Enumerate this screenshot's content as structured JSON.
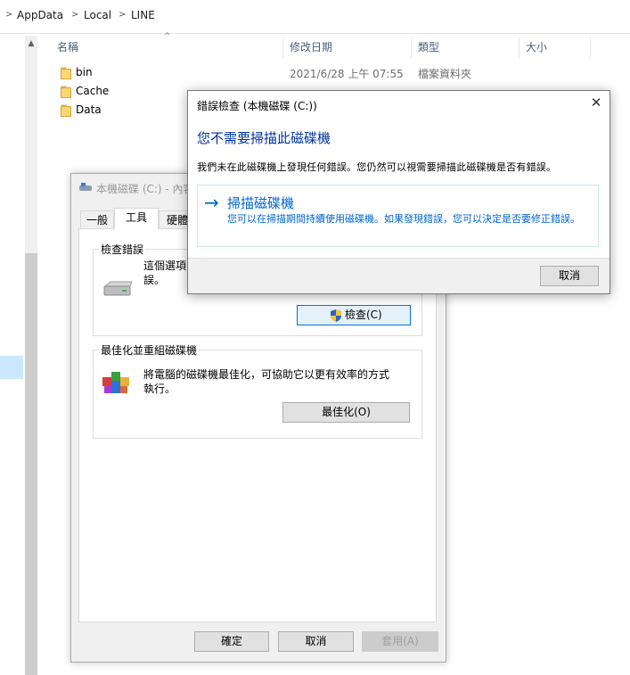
{
  "breadcrumb": {
    "items": [
      "AppData",
      "Local",
      "LINE"
    ]
  },
  "columns": {
    "name": "名稱",
    "modified": "修改日期",
    "type": "類型",
    "size": "大小"
  },
  "files": [
    {
      "name": "bin",
      "date": "2021/6/28 上午 07:55",
      "type": "檔案資料夾"
    },
    {
      "name": "Cache",
      "date": "",
      "type": ""
    },
    {
      "name": "Data",
      "date": "",
      "type": ""
    }
  ],
  "properties_dialog": {
    "title": "本機磁碟 (C:) - 內容",
    "tabs": [
      "一般",
      "工具",
      "硬體"
    ],
    "active_tab": "工具",
    "error_check_group": {
      "legend": "檢查錯誤",
      "text": "這個選項\n誤。",
      "button": "檢查(C)"
    },
    "optimize_group": {
      "legend": "最佳化並重組磁碟機",
      "text_line1": "將電腦的磁碟機最佳化，可協助它以更有效率的方式",
      "text_line2": "執行。",
      "button": "最佳化(O)"
    },
    "buttons": {
      "ok": "確定",
      "cancel": "取消",
      "apply": "套用(A)"
    }
  },
  "error_dialog": {
    "title": "錯誤檢查 (本機磁碟 (C:))",
    "close": "✕",
    "heading": "您不需要掃描此磁碟機",
    "description": "我們未在此磁碟機上發現任何錯誤。您仍然可以視需要掃描此磁碟機是否有錯誤。",
    "scan_title": "掃描磁碟機",
    "scan_desc": "您可以在掃描期間持續使用磁碟機。如果發現錯誤，您可以決定是否要修正錯誤。",
    "cancel": "取消"
  },
  "colors": {
    "accent": "#0066cc",
    "heading": "#0033a0",
    "folder": "#f8d775"
  }
}
